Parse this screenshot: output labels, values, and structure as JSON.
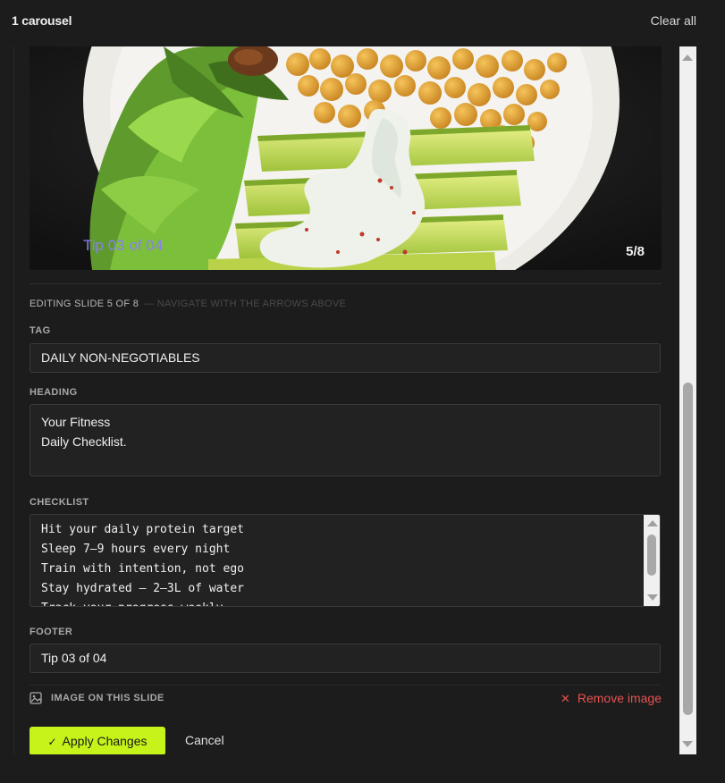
{
  "header": {
    "title": "1 carousel",
    "clear_label": "Clear all"
  },
  "preview": {
    "overlay_footer": "Tip 03 of 04",
    "counter": "5/8"
  },
  "editor": {
    "editing_label": "EDITING SLIDE 5 OF 8",
    "editing_hint": "— NAVIGATE WITH THE ARROWS ABOVE",
    "tag": {
      "label": "TAG",
      "value": "DAILY NON-NEGOTIABLES"
    },
    "heading": {
      "label": "HEADING",
      "lines": [
        "Your Fitness",
        "Daily Checklist."
      ]
    },
    "checklist": {
      "label": "CHECKLIST",
      "lines": [
        "Hit your daily protein target",
        "Sleep 7–9 hours every night",
        "Train with intention, not ego",
        "Stay hydrated — 2–3L of water",
        "Track your progress weekly"
      ]
    },
    "footer": {
      "label": "FOOTER",
      "value": "Tip 03 of 04"
    },
    "image": {
      "label": "IMAGE ON THIS SLIDE",
      "remove_label": "Remove image",
      "icon": "image-icon"
    },
    "actions": {
      "apply_label": "Apply Changes",
      "cancel_label": "Cancel"
    }
  },
  "colors": {
    "accent": "#c6f31a",
    "danger": "#e55252",
    "overlay_text": "#8b7ff0"
  }
}
